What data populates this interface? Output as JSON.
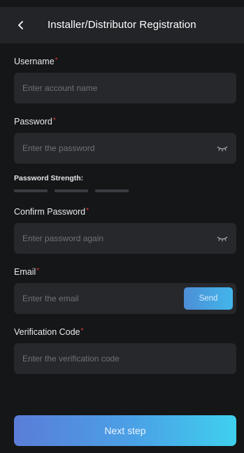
{
  "header": {
    "title": "Installer/Distributor Registration",
    "back_icon": "chevron-left-icon"
  },
  "required_marker": "*",
  "fields": {
    "username": {
      "label": "Username",
      "placeholder": "Enter account name",
      "value": ""
    },
    "password": {
      "label": "Password",
      "placeholder": "Enter the password",
      "value": "",
      "toggle_icon": "eye-closed-icon"
    },
    "confirm_password": {
      "label": "Confirm Password",
      "placeholder": "Enter password again",
      "value": "",
      "toggle_icon": "eye-closed-icon"
    },
    "email": {
      "label": "Email",
      "placeholder": "Enter the email",
      "value": "",
      "send_label": "Send"
    },
    "verification_code": {
      "label": "Verification Code",
      "placeholder": "Enter the verification code",
      "value": ""
    }
  },
  "password_strength": {
    "label": "Password Strength:",
    "segments_filled": 0,
    "segments_total": 3
  },
  "next_button": {
    "label": "Next step"
  },
  "colors": {
    "background": "#151618",
    "header": "#222428",
    "field": "#26282c",
    "required": "#e0413a",
    "accent_start": "#5a7dd8",
    "accent_end": "#3fd0ee"
  }
}
